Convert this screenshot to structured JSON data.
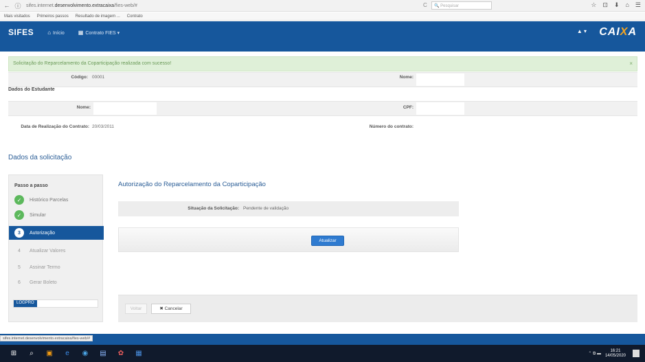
{
  "browser": {
    "back_icon": "arrow-left-icon",
    "url_prefix": "sifes.internet.",
    "url_main": "desenvolvimento.extracaixa",
    "url_suffix": "/fies-web/#",
    "reload": "C",
    "search_placeholder": "Pesquisar",
    "toolbar_icons": [
      "☆",
      "⊡",
      "⬇",
      "⌂",
      "☰"
    ]
  },
  "bookmarks": [
    "Mais visitados",
    "Primeiros passos",
    "Resultado de imagem ...",
    "Contrato"
  ],
  "header": {
    "brand": "SIFES",
    "nav": [
      {
        "icon": "⌂",
        "label": "Início"
      },
      {
        "icon": "▦",
        "label": "Contrato FIES ▾"
      }
    ],
    "user_menu": "▲ ▾",
    "logo_pre": "CAI",
    "logo_x": "X",
    "logo_post": "A",
    "color": "#16579c"
  },
  "alert": {
    "message": "Solicitação do Reparcelamento da Coparticipação realizada com sucesso!",
    "close": "×"
  },
  "contract": {
    "codigo_label": "Código:",
    "codigo_value": "00001",
    "nome_label": "Nome:"
  },
  "student": {
    "section": "Dados do Estudante",
    "nome_label": "Nome:",
    "cpf_label": "CPF:",
    "data_label": "Data de Realização do Contrato:",
    "data_value": "20/03/2011",
    "numero_label": "Número do contrato:"
  },
  "request": {
    "section_title": "Dados da solicitação",
    "steps_title": "Passo a passo",
    "steps": [
      {
        "num": "✓",
        "label": "Histórico Parcelas",
        "state": "done"
      },
      {
        "num": "✓",
        "label": "Simular",
        "state": "done"
      },
      {
        "num": "3",
        "label": "Autorização",
        "state": "active"
      },
      {
        "num": "4",
        "label": "Atualizar Valores",
        "state": "pending"
      },
      {
        "num": "5",
        "label": "Assinar Termo",
        "state": "pending"
      },
      {
        "num": "6",
        "label": "Gerar Boleto",
        "state": "pending"
      }
    ],
    "logout": "LOGPRO"
  },
  "panel": {
    "title": "Autorização do Reparcelamento da Coparticipação",
    "situation_label": "Situação da Solicitação:",
    "situation_value": "Pendente de validação",
    "update_button": "Atualizar",
    "back_button": "Voltar",
    "cancel_button": "✖ Cancelar"
  },
  "status_url": "sifes.internet.desenvolvimento.extracaixa/fies-web/#",
  "taskbar": {
    "icons": [
      "⊞",
      "⌕",
      "▣",
      "e",
      "◉",
      "▤",
      "✿",
      "▦"
    ],
    "tray": "⌃  ⧉  ▬",
    "time": "16:21",
    "date": "14/05/2020"
  }
}
